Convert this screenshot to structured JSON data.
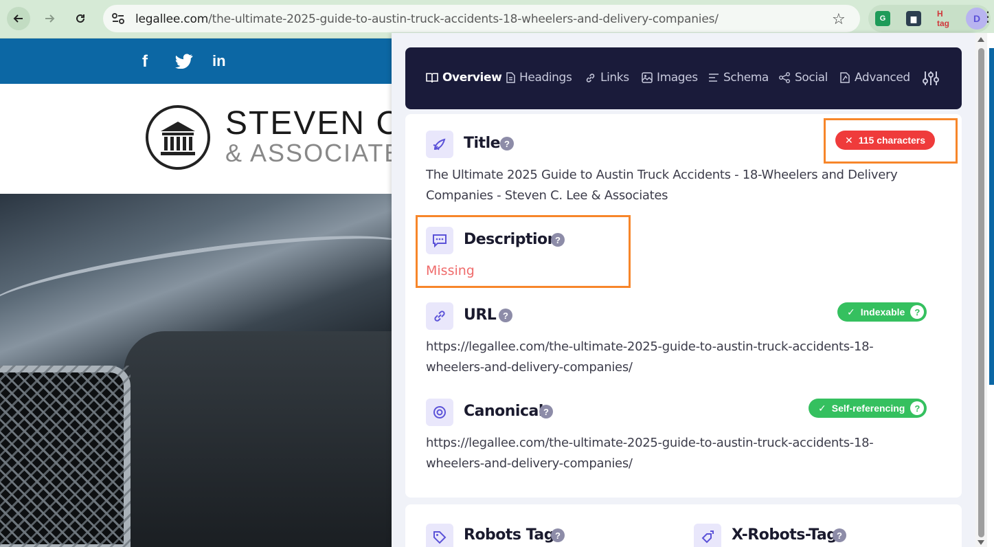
{
  "browser": {
    "url_host": "legallee.com",
    "url_path": "/the-ultimate-2025-guide-to-austin-truck-accidents-18-wheelers-and-delivery-companies/",
    "extensions": [
      "G",
      "H tag",
      "D"
    ]
  },
  "site": {
    "social": [
      "f",
      "t",
      "in"
    ],
    "logo_line1": "STEVEN C.",
    "logo_line2": "& ASSOCIATES"
  },
  "panel": {
    "tabs": [
      {
        "label": "Overview",
        "icon": "book-icon",
        "active": true
      },
      {
        "label": "Headings",
        "icon": "document-icon"
      },
      {
        "label": "Links",
        "icon": "link-icon"
      },
      {
        "label": "Images",
        "icon": "image-icon"
      },
      {
        "label": "Schema",
        "icon": "list-icon"
      },
      {
        "label": "Social",
        "icon": "share-icon"
      },
      {
        "label": "Advanced",
        "icon": "advanced-icon"
      }
    ],
    "title": {
      "label": "Title",
      "badge": "115 characters",
      "badge_status": "error",
      "value": "The Ultimate 2025 Guide to Austin Truck Accidents - 18-Wheelers and Delivery Companies - Steven C. Lee & Associates"
    },
    "description": {
      "label": "Description",
      "value": "Missing"
    },
    "url": {
      "label": "URL",
      "badge": "Indexable",
      "value": "https://legallee.com/the-ultimate-2025-guide-to-austin-truck-accidents-18-wheelers-and-delivery-companies/"
    },
    "canonical": {
      "label": "Canonical",
      "badge": "Self-referencing",
      "value": "https://legallee.com/the-ultimate-2025-guide-to-austin-truck-accidents-18-wheelers-and-delivery-companies/"
    },
    "robots": {
      "label": "Robots Tag"
    },
    "xrobots": {
      "label": "X-Robots-Tag"
    }
  },
  "colors": {
    "accent": "#5b52d8",
    "tab_bg": "#1a1b3a",
    "error": "#ef3b3b",
    "success": "#35c05f",
    "highlight": "#f7862a"
  }
}
